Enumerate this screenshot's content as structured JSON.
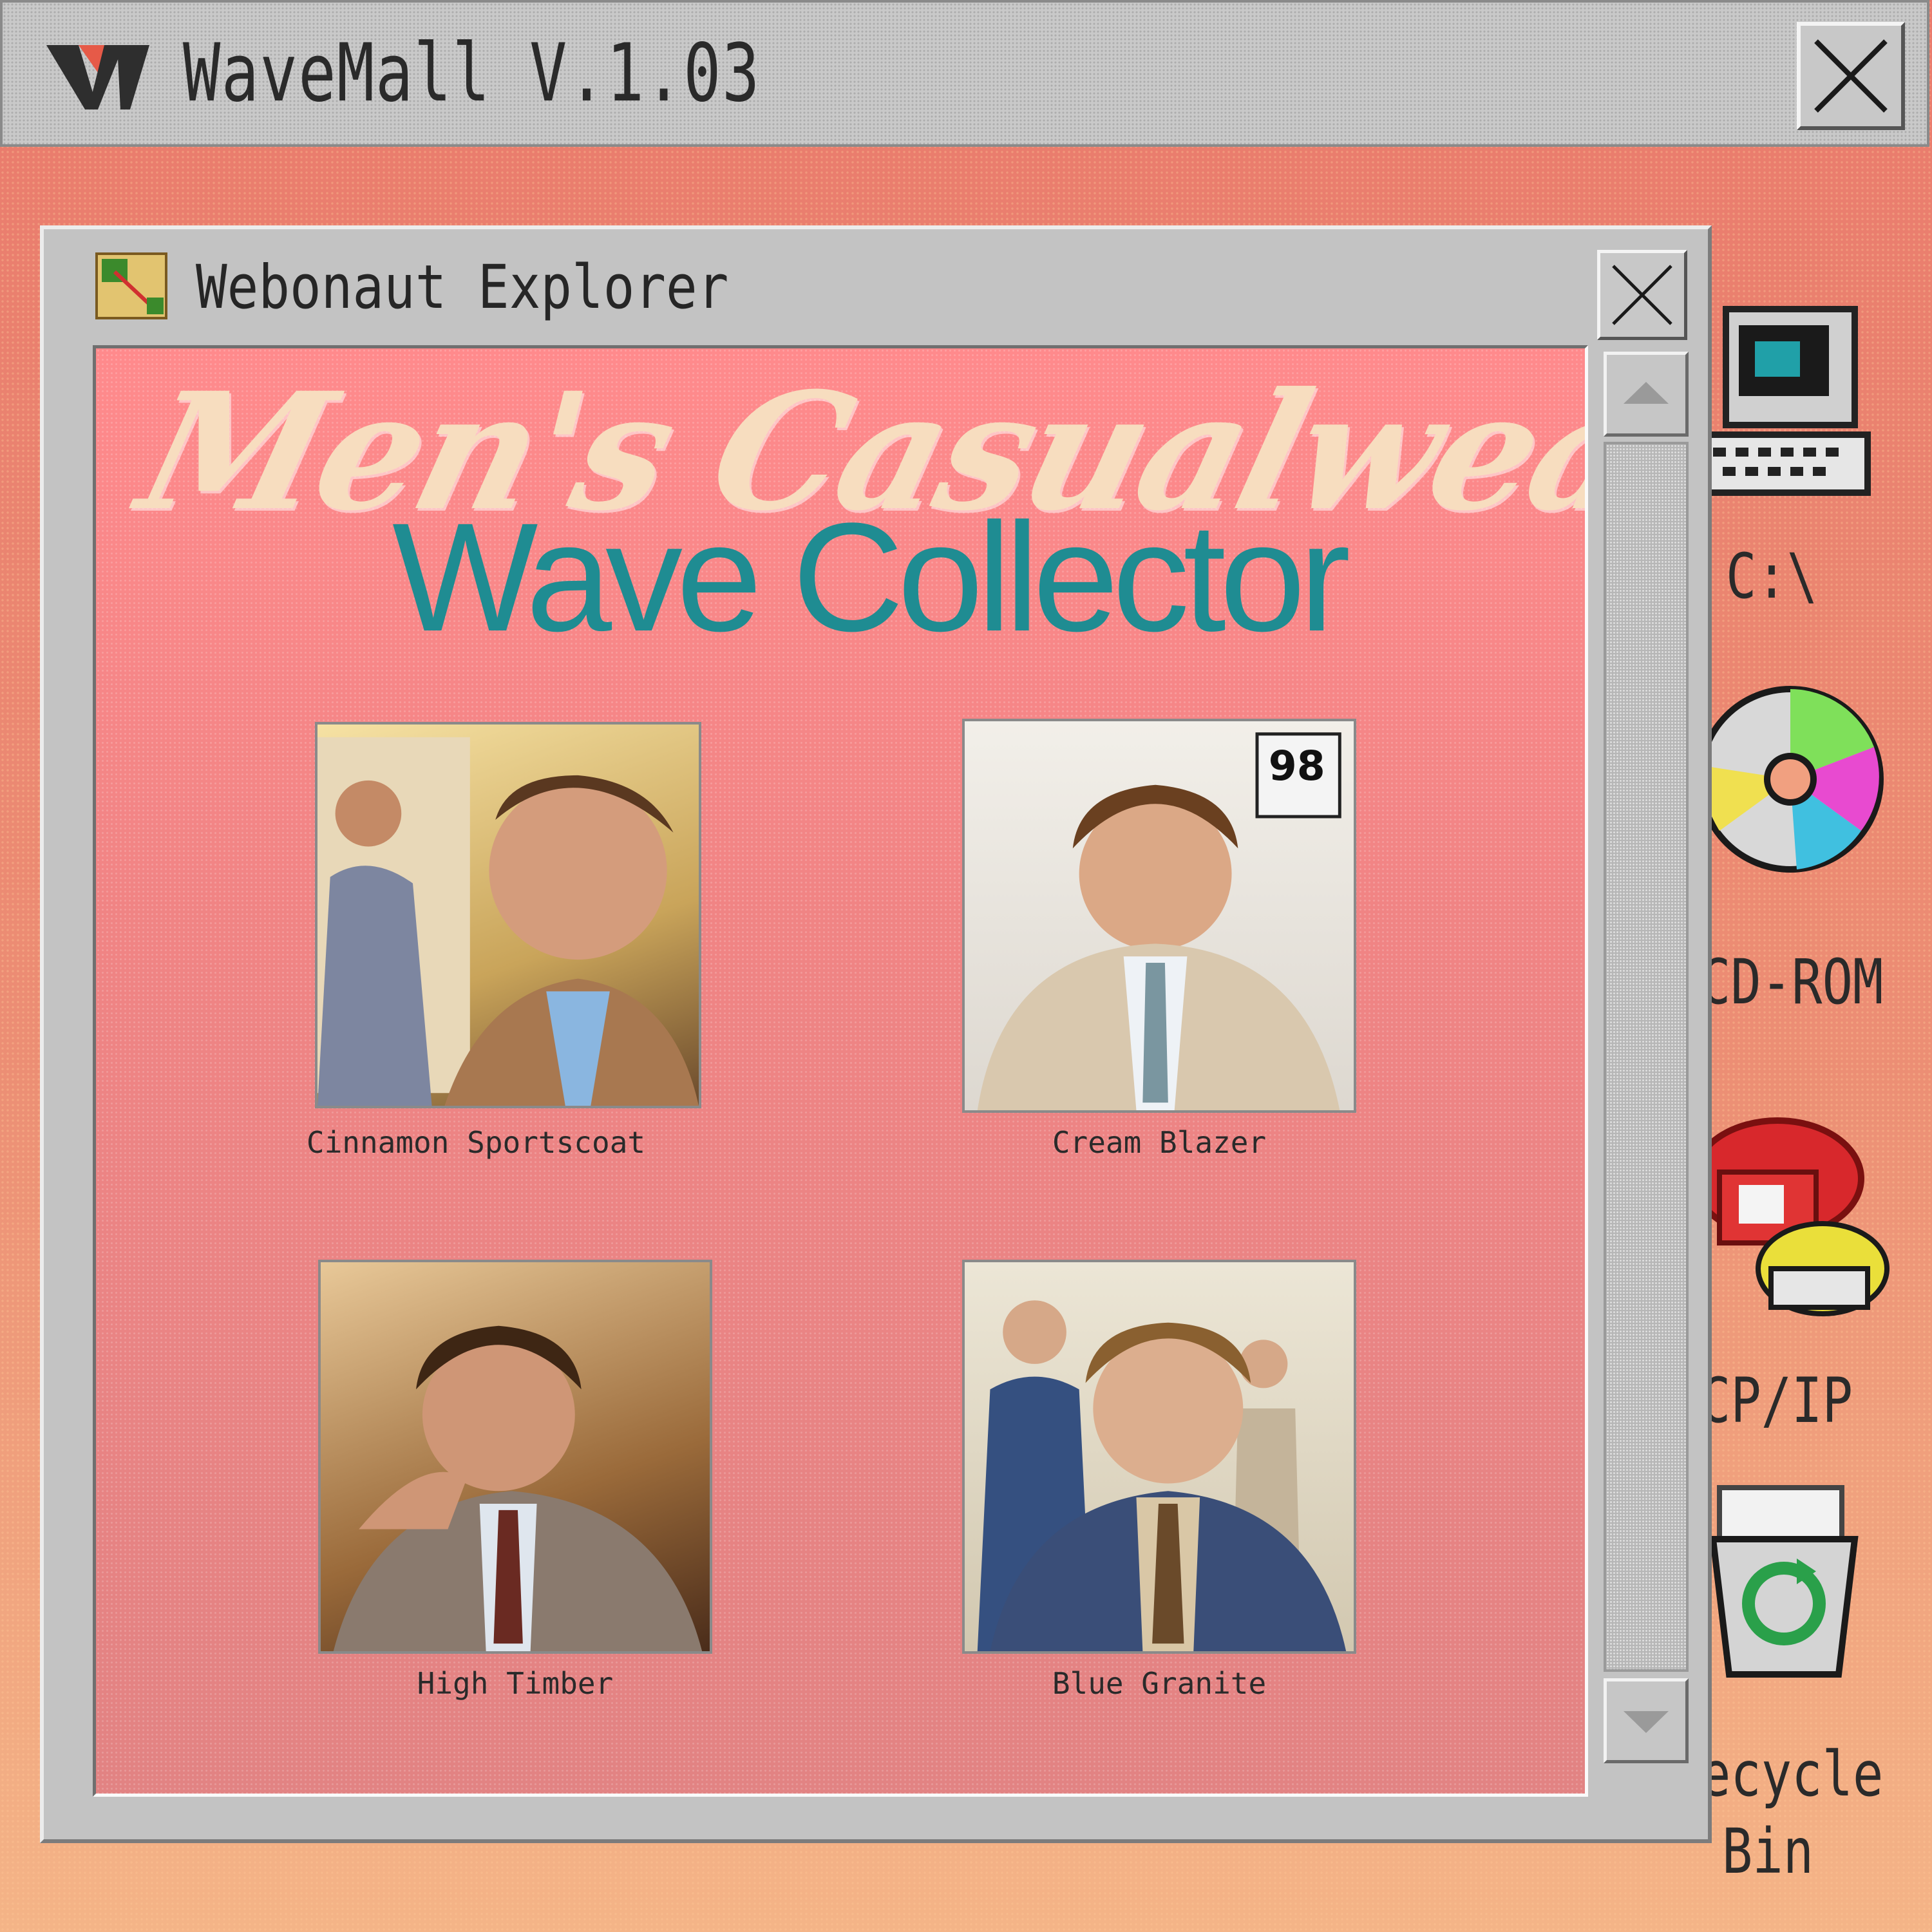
{
  "app": {
    "title": "WaveMall V.1.03"
  },
  "explorer": {
    "title": "Webonaut Explorer",
    "banner": {
      "script_title": "Men's Casualwear",
      "subtitle": "Wave Collector"
    },
    "products": [
      {
        "name": "Cinnamon Sportscoat",
        "jacket_color": "#a87850"
      },
      {
        "name": "Cream Blazer",
        "jacket_color": "#d9c8ae"
      },
      {
        "name": "High Timber",
        "jacket_color": "#8a7a6e"
      },
      {
        "name": "Blue Granite",
        "jacket_color": "#3a4e78"
      }
    ]
  },
  "desktop": {
    "icons": [
      {
        "label": "C:\\",
        "icon": "computer-icon"
      },
      {
        "label": "CD-ROM",
        "icon": "cd-rom-icon"
      },
      {
        "label": "CP/IP",
        "icon": "telephone-icon"
      },
      {
        "label": "ecycle",
        "label2": "Bin",
        "icon": "recycle-bin-icon"
      }
    ]
  },
  "colors": {
    "desktop_top": "#e97a6c",
    "desktop_bottom": "#f4b487",
    "content_bg": "#f08484",
    "banner_script": "#f7ddbf",
    "banner_subtitle": "#1f8c92",
    "window_gray": "#c3c3c3"
  }
}
